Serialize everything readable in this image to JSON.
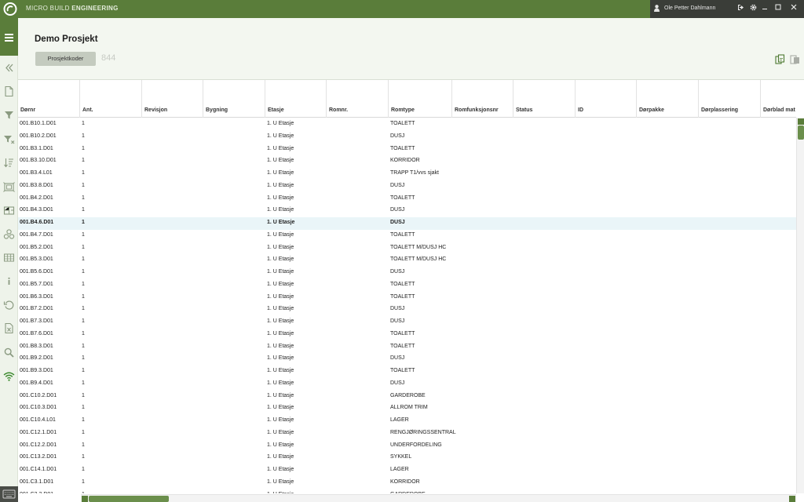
{
  "app": {
    "brand_light": "MICRO BUILD ",
    "brand_bold": "ENGINEERING",
    "user_name": "Ole Petter Dahlmann",
    "accent": "#5a7d3a"
  },
  "header": {
    "title": "Demo Prosjekt",
    "codes_button": "Prosjektkoder",
    "code_value": "844"
  },
  "table": {
    "columns": [
      "Dørnr",
      "Ant.",
      "Revisjon",
      "Bygning",
      "Etasje",
      "Romnr.",
      "Romtype",
      "Romfunksjonsnr",
      "Status",
      "ID",
      "Dørpakke",
      "Dørplassering",
      "Dørblad mat"
    ],
    "rows": [
      [
        "001.B10.1.D01",
        "1",
        "1. U Etasje",
        "TOALETT"
      ],
      [
        "001.B10.2.D01",
        "1",
        "1. U Etasje",
        "DUSJ"
      ],
      [
        "001.B3.1.D01",
        "1",
        "1. U Etasje",
        "TOALETT"
      ],
      [
        "001.B3.10.D01",
        "1",
        "1. U Etasje",
        "KORRIDOR"
      ],
      [
        "001.B3.4.L01",
        "1",
        "1. U Etasje",
        "TRAPP T1/vvs sjakt"
      ],
      [
        "001.B3.8.D01",
        "1",
        "1. U Etasje",
        "DUSJ"
      ],
      [
        "001.B4.2.D01",
        "1",
        "1. U Etasje",
        "TOALETT"
      ],
      [
        "001.B4.3.D01",
        "1",
        "1. U Etasje",
        "DUSJ"
      ],
      [
        "001.B4.6.D01",
        "1",
        "1. U Etasje",
        "DUSJ"
      ],
      [
        "001.B4.7.D01",
        "1",
        "1. U Etasje",
        "TOALETT"
      ],
      [
        "001.B5.2.D01",
        "1",
        "1. U Etasje",
        "TOALETT M/DUSJ HC"
      ],
      [
        "001.B5.3.D01",
        "1",
        "1. U Etasje",
        "TOALETT M/DUSJ HC"
      ],
      [
        "001.B5.6.D01",
        "1",
        "1. U Etasje",
        "DUSJ"
      ],
      [
        "001.B5.7.D01",
        "1",
        "1. U Etasje",
        "TOALETT"
      ],
      [
        "001.B6.3.D01",
        "1",
        "1. U Etasje",
        "TOALETT"
      ],
      [
        "001.B7.2.D01",
        "1",
        "1. U Etasje",
        "DUSJ"
      ],
      [
        "001.B7.3.D01",
        "1",
        "1. U Etasje",
        "DUSJ"
      ],
      [
        "001.B7.6.D01",
        "1",
        "1. U Etasje",
        "TOALETT"
      ],
      [
        "001.B8.3.D01",
        "1",
        "1. U Etasje",
        "TOALETT"
      ],
      [
        "001.B9.2.D01",
        "1",
        "1. U Etasje",
        "DUSJ"
      ],
      [
        "001.B9.3.D01",
        "1",
        "1. U Etasje",
        "TOALETT"
      ],
      [
        "001.B9.4.D01",
        "1",
        "1. U Etasje",
        "DUSJ"
      ],
      [
        "001.C10.2.D01",
        "1",
        "1. U Etasje",
        "GARDEROBE"
      ],
      [
        "001.C10.3.D01",
        "1",
        "1. U Etasje",
        "ALLROM TRIM"
      ],
      [
        "001.C10.4.L01",
        "1",
        "1. U Etasje",
        "LAGER"
      ],
      [
        "001.C12.1.D01",
        "1",
        "1. U Etasje",
        "RENGJØRINGSSENTRAL"
      ],
      [
        "001.C12.2.D01",
        "1",
        "1. U Etasje",
        "UNDERFORDELING"
      ],
      [
        "001.C13.2.D01",
        "1",
        "1. U Etasje",
        "SYKKEL"
      ],
      [
        "001.C14.1.D01",
        "1",
        "1. U Etasje",
        "LAGER"
      ],
      [
        "001.C3.1.D01",
        "1",
        "1. U Etasje",
        "KORRIDOR"
      ],
      [
        "001.C3.2.D01",
        "1",
        "1. U Etasje",
        "GARDEROBE"
      ]
    ],
    "selected_row": 8
  },
  "icons": {
    "sidebar": [
      "collapse-icon",
      "document-icon",
      "filter-icon",
      "filter-clear-icon",
      "sort-icon",
      "floor-plan-icon",
      "building-plan-icon",
      "components-icon",
      "grid-icon",
      "info-icon",
      "history-icon",
      "excel-icon",
      "search-icon",
      "wifi-icon"
    ],
    "header": [
      "copy-icon",
      "paste-icon"
    ]
  }
}
